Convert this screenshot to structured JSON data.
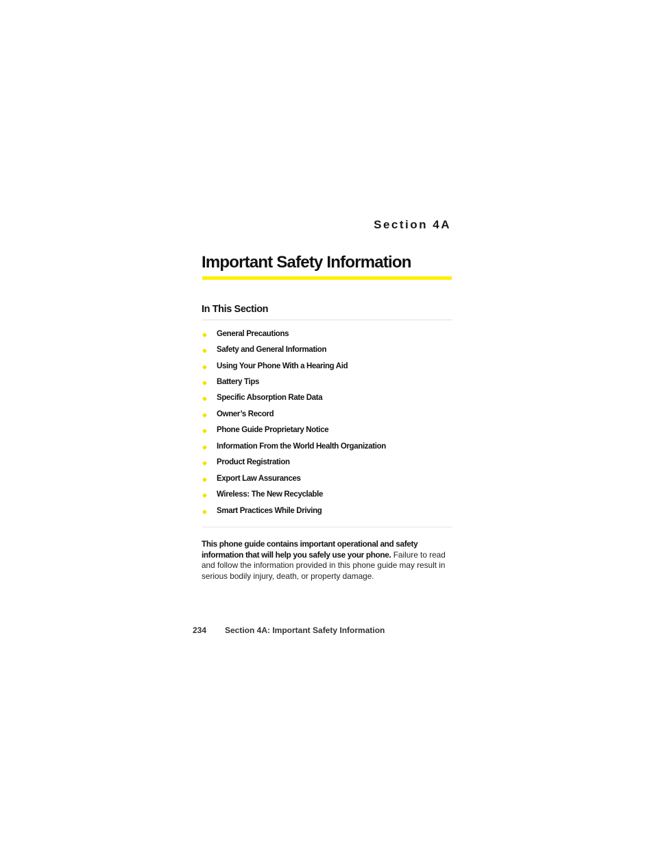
{
  "section_label": "Section 4A",
  "page_title": "Important Safety Information",
  "in_this_section": {
    "heading": "In This Section",
    "items": [
      {
        "label": "General Precautions"
      },
      {
        "label": "Safety and General Information"
      },
      {
        "label": "Using Your Phone With a Hearing Aid"
      },
      {
        "label": "Battery Tips"
      },
      {
        "label": "Specific Absorption Rate Data"
      },
      {
        "label": "Owner’s Record"
      },
      {
        "label": "Phone Guide Proprietary Notice"
      },
      {
        "label": "Information From the World Health Organization"
      },
      {
        "label": "Product Registration"
      },
      {
        "label": "Export Law Assurances"
      },
      {
        "label": "Wireless: The New Recyclable"
      },
      {
        "label": "Smart Practices While Driving"
      }
    ]
  },
  "intro": {
    "bold": "This phone guide contains important operational and safety information that will help you safely use your phone.",
    "regular": " Failure to read and follow the information provided in this phone guide may result in serious bodily injury, death, or property damage."
  },
  "footer": {
    "page_number": "234",
    "running_title": "Section 4A: Important Safety Information"
  },
  "colors": {
    "accent_yellow": "#ffef00",
    "bullet_yellow": "#f4e200"
  }
}
